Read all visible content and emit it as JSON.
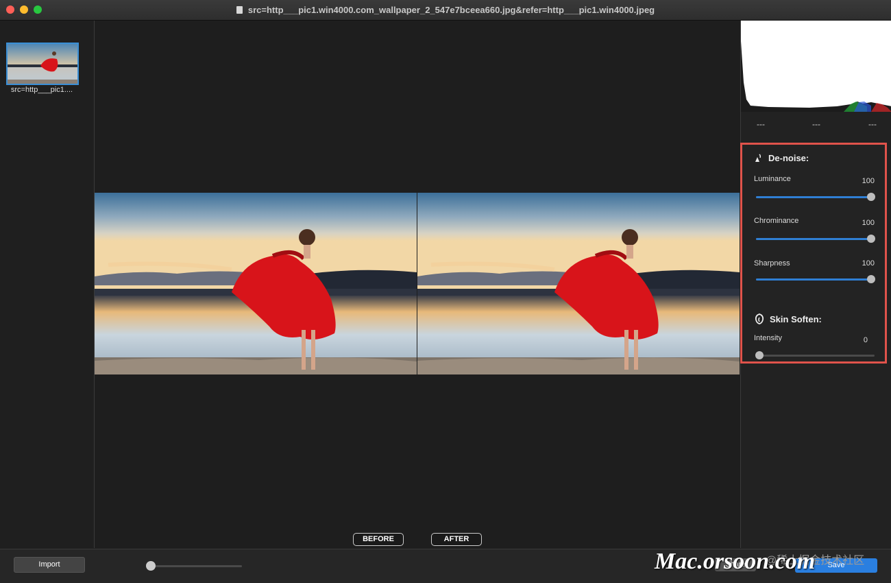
{
  "window": {
    "title": "src=http___pic1.win4000.com_wallpaper_2_547e7bceea660.jpg&refer=http___pic1.win4000.jpeg",
    "traffic_colors": [
      "#ff5f57",
      "#febc2e",
      "#28c840"
    ]
  },
  "sidebar": {
    "thumbnail_label": "src=http___pic1...."
  },
  "histogram": {
    "values": [
      "---",
      "---",
      "---"
    ]
  },
  "denoise": {
    "title": "De-noise:",
    "sliders": [
      {
        "label": "Luminance",
        "value": "100",
        "fraction": 1.0
      },
      {
        "label": "Chrominance",
        "value": "100",
        "fraction": 1.0
      },
      {
        "label": "Sharpness",
        "value": "100",
        "fraction": 1.0
      }
    ]
  },
  "skin": {
    "title": "Skin Soften:",
    "slider": {
      "label": "Intensity",
      "value": "0",
      "fraction": 0.0
    }
  },
  "view_buttons": {
    "before": "BEFORE",
    "after": "AFTER"
  },
  "bottom": {
    "import_label": "Import",
    "zoom_fraction": 0.0,
    "share_label": "Share",
    "save_label": "Save"
  },
  "watermark": {
    "main": "Mac.orsoon.com",
    "secondary": "@稀土掘金技术社区"
  },
  "colors": {
    "accent": "#2f7fd4",
    "highlight_box": "#e0534b",
    "dress_red": "#d8141a"
  }
}
